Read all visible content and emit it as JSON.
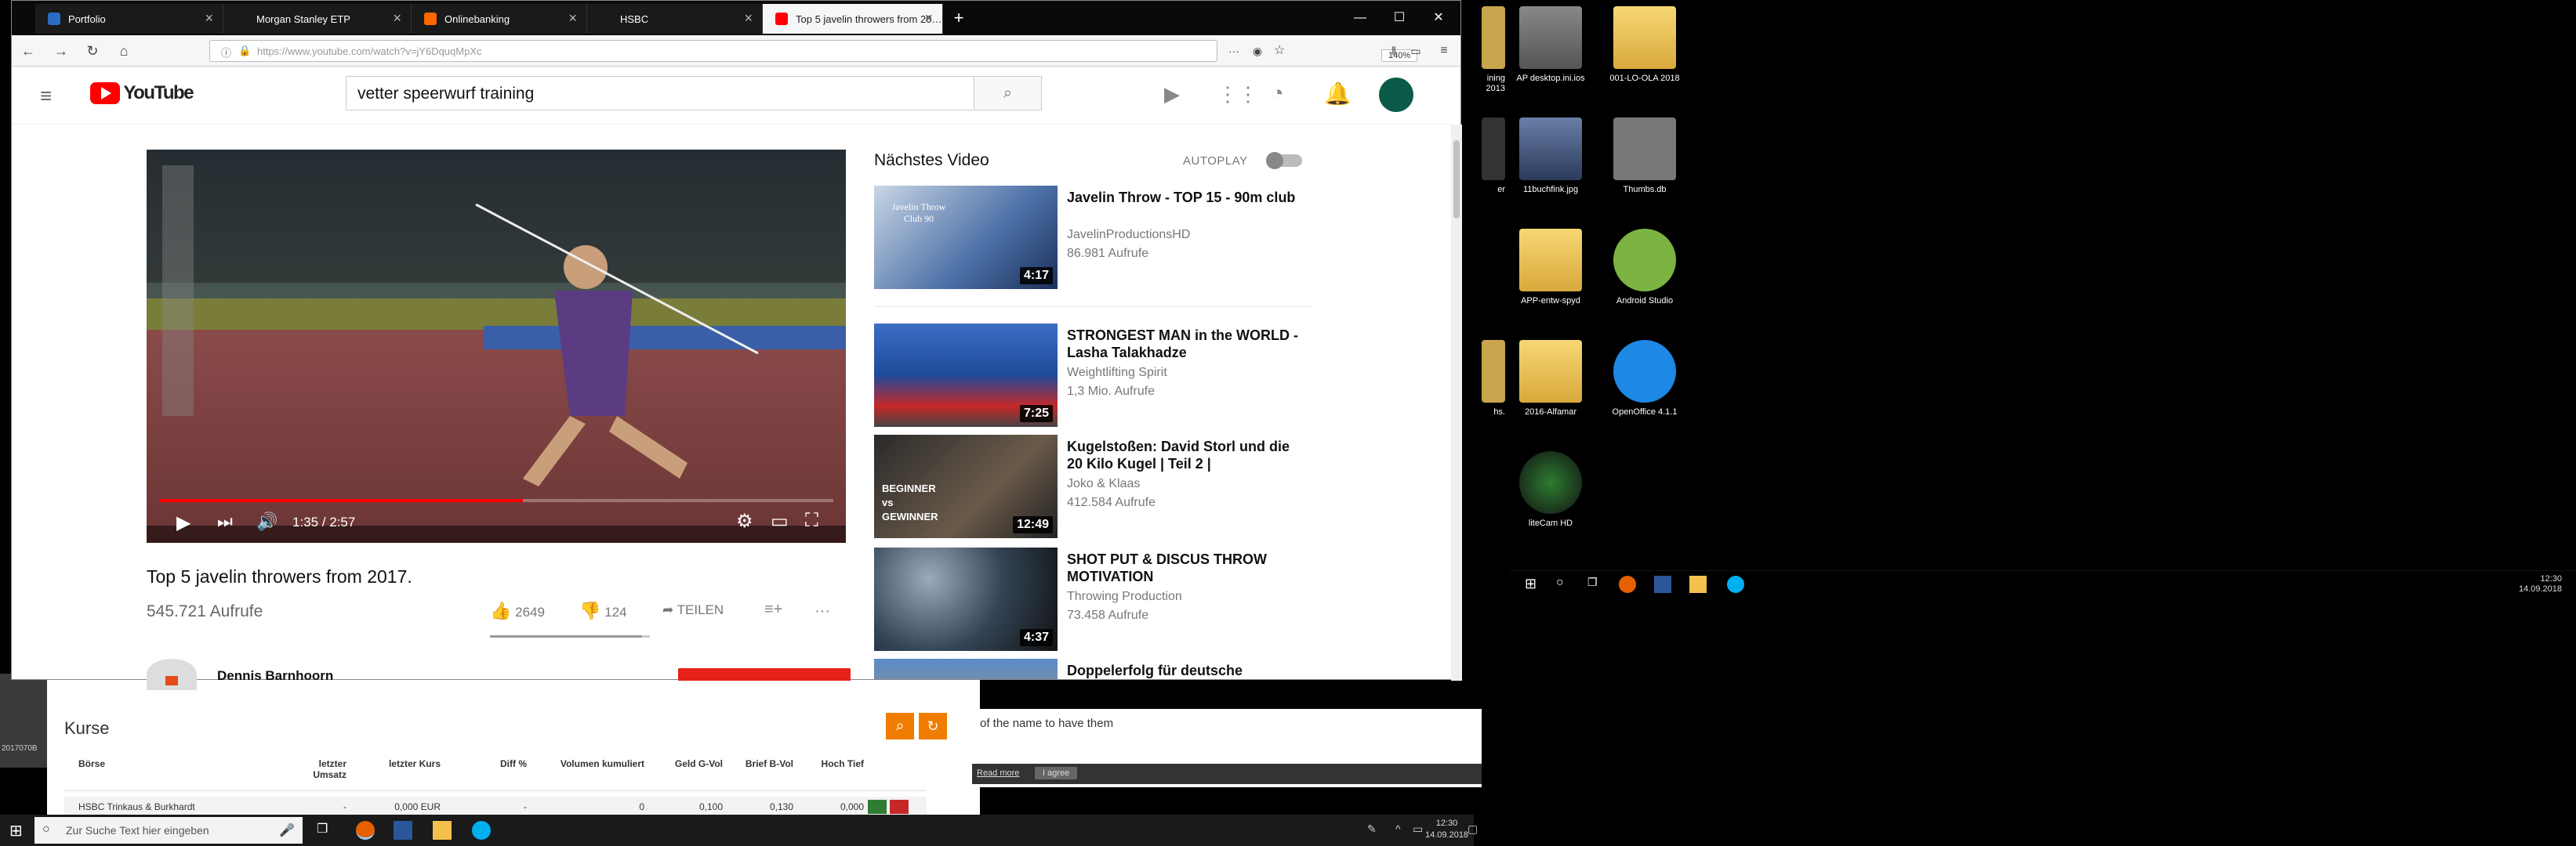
{
  "browser": {
    "tabs": [
      {
        "label": "Portfolio",
        "favicon_color": "#2c6cc4"
      },
      {
        "label": "Morgan Stanley ETP",
        "favicon_color": "#4a4a4a"
      },
      {
        "label": "Onlinebanking",
        "favicon_color": "#ff6600"
      },
      {
        "label": "HSBC",
        "favicon_color": "#1a1a1a"
      },
      {
        "label": "Top 5 javelin throwers from 20…",
        "favicon_color": "#ff0000"
      }
    ],
    "url": "https://www.youtube.com/watch?v=jY6DquqMpXc",
    "zoom": "140%",
    "new_tab": "+",
    "min": "—",
    "max": "☐",
    "close": "✕"
  },
  "youtube": {
    "logo": "YouTube",
    "search_value": "vetter speerwurf training",
    "player": {
      "time": "1:35 / 2:57",
      "progress": 0.54
    },
    "title": "Top 5 javelin throwers from 2017.",
    "views": "545.721 Aufrufe",
    "likes": "2649",
    "dislikes": "124",
    "share": "TEILEN",
    "more": "···",
    "channel": "Dennis Barnhoorn",
    "up_next": "Nächstes Video",
    "autoplay": "AUTOPLAY",
    "videos": [
      {
        "title": "Javelin Throw - TOP 15 - 90m club",
        "channel": "JavelinProductionsHD",
        "views": "86.981 Aufrufe",
        "duration": "4:17",
        "thumb_text": "Javelin Throw Club 90"
      },
      {
        "title": "STRONGEST MAN in the WORLD - Lasha Talakhadze",
        "channel": "Weightlifting Spirit",
        "views": "1,3 Mio. Aufrufe",
        "duration": "7:25",
        "thumb_text": ""
      },
      {
        "title": "Kugelstoßen: David Storl und die 20 Kilo Kugel | Teil 2 |",
        "channel": "Joko & Klaas",
        "views": "412.584 Aufrufe",
        "duration": "12:49",
        "thumb_text": "BEGINNER vs GEWINNER"
      },
      {
        "title": "SHOT PUT & DISCUS THROW MOTIVATION",
        "channel": "Throwing Production",
        "views": "73.458 Aufrufe",
        "duration": "4:37",
        "thumb_text": ""
      },
      {
        "title": "Doppelerfolg für deutsche",
        "channel": "",
        "views": "",
        "duration": "",
        "thumb_text": ""
      }
    ]
  },
  "kurse": {
    "title": "Kurse",
    "headers": [
      "Börse",
      "letzter Umsatz",
      "letzter Kurs",
      "Diff %",
      "Volumen kumuliert",
      "Geld G-Vol",
      "Brief B-Vol",
      "Hoch Tief"
    ],
    "row": [
      "HSBC Trinkaus & Burkhardt",
      "-",
      "0,000 EUR",
      "-",
      "0",
      "0,100",
      "0,130",
      "0,000"
    ]
  },
  "cookie": {
    "text": "of the name to have them",
    "read_more": "Read more",
    "agree": "I agree"
  },
  "taskbar": {
    "search_placeholder": "Zur Suche Text hier eingeben",
    "time": "12:30",
    "date": "14.09.2018"
  },
  "taskbar2": {
    "time": "12:30",
    "date": "14.09.2018"
  },
  "desktop": {
    "icons": [
      {
        "label": "ining 2013"
      },
      {
        "label": "AP desktop.ini.ios"
      },
      {
        "label": "001-LO-OLA 2018"
      },
      {
        "label": "er"
      },
      {
        "label": "11buchfink.jpg"
      },
      {
        "label": "Thumbs.db"
      },
      {
        "label": "APP-entw-spyd"
      },
      {
        "label": "Android Studio"
      },
      {
        "label": "hs."
      },
      {
        "label": "2016-Alfamar"
      },
      {
        "label": "OpenOffice 4.1.1"
      },
      {
        "label": "liteCam HD"
      }
    ]
  },
  "leftside": {
    "label": "2017070B"
  }
}
